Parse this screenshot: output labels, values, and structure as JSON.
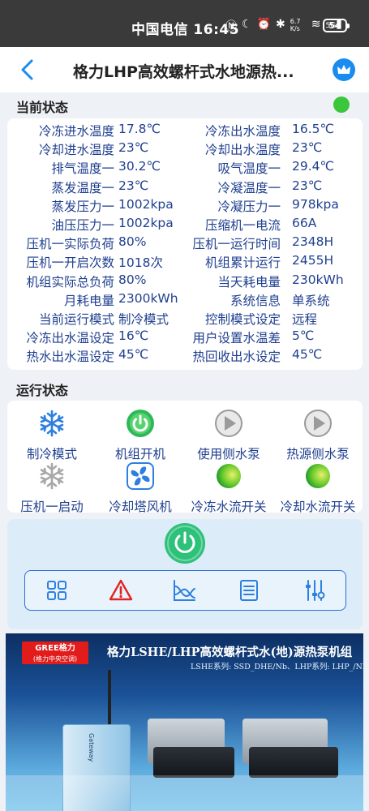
{
  "status_bar": {
    "carrier": "中国电信",
    "time": "16:45",
    "icons": [
      "nfc-icon",
      "dnd-icon",
      "alarm-icon",
      "bluetooth-icon",
      "net-speed-icon",
      "wifi-icon",
      "signal-5g-icon"
    ],
    "net_speed": "6.7 K/s",
    "network": "5G",
    "battery": "54"
  },
  "header": {
    "title": "格力LHP高效螺杆式水地源热...",
    "back_icon": "chevron-left-icon",
    "action_icon": "crown-icon"
  },
  "current_status": {
    "label": "当前状态",
    "indicator_color": "#3cc63c",
    "rows": [
      {
        "l1": "冷冻进水温度",
        "v1": "17.8℃",
        "l2": "冷冻出水温度",
        "v2": "16.5℃"
      },
      {
        "l1": "冷却进水温度",
        "v1": "23℃",
        "l2": "冷却出水温度",
        "v2": "23℃"
      },
      {
        "l1": "排气温度一",
        "v1": "30.2℃",
        "l2": "吸气温度一",
        "v2": "29.4℃"
      },
      {
        "l1": "蒸发温度一",
        "v1": "23℃",
        "l2": "冷凝温度一",
        "v2": "23℃"
      },
      {
        "l1": "蒸发压力一",
        "v1": "1002kpa",
        "l2": "冷凝压力一",
        "v2": "978kpa"
      },
      {
        "l1": "油压压力一",
        "v1": "1002kpa",
        "l2": "压缩机一电流",
        "v2": "66A"
      },
      {
        "l1": "压机一实际负荷",
        "v1": "80%",
        "l2": "压机一运行时间",
        "v2": "2348H"
      },
      {
        "l1": "压机一开启次数",
        "v1": "1018次",
        "l2": "机组累计运行",
        "v2": "2455H"
      },
      {
        "l1": "机组实际总负荷",
        "v1": "80%",
        "l2": "当天耗电量",
        "v2": "230kWh"
      },
      {
        "l1": "月耗电量",
        "v1": "2300kWh",
        "l2": "系统信息",
        "v2": "单系统"
      },
      {
        "l1": "当前运行模式",
        "v1": "制冷模式",
        "l2": "控制模式设定",
        "v2": "远程"
      },
      {
        "l1": "冷冻出水温设定",
        "v1": "16℃",
        "l2": "用户设置水温差",
        "v2": "5℃"
      },
      {
        "l1": "热水出水温设定",
        "v1": "45℃",
        "l2": "热回收出水设定",
        "v2": "45℃"
      }
    ]
  },
  "run_status": {
    "label": "运行状态",
    "items": [
      {
        "label": "制冷模式",
        "icon": "snowflake-icon"
      },
      {
        "label": "机组开机",
        "icon": "power-on-icon"
      },
      {
        "label": "使用侧水泵",
        "icon": "pump-play-icon"
      },
      {
        "label": "热源侧水泵",
        "icon": "pump-play-icon"
      },
      {
        "label": "压机一启动",
        "icon": "snowflake-gray-icon"
      },
      {
        "label": "冷却塔风机",
        "icon": "fan-icon"
      },
      {
        "label": "冷冻水流开关",
        "icon": "green-ball-icon"
      },
      {
        "label": "冷却水流开关",
        "icon": "green-ball-icon"
      }
    ]
  },
  "controls": {
    "power_icon": "power-icon",
    "tools": [
      "grid-icon",
      "alarm-warning-icon",
      "curve-chart-icon",
      "list-icon",
      "sliders-icon"
    ]
  },
  "banner": {
    "logo": "GREE格力",
    "logo_sub": "(格力中央空调)",
    "title": "格力LSHE/LHP高效螺杆式水(地)源热泵机组",
    "subtitle": "LSHE系列: SSD_DHE/Nb、LHP系列: LHP_/Nb",
    "gateway_text": "Gateway"
  }
}
